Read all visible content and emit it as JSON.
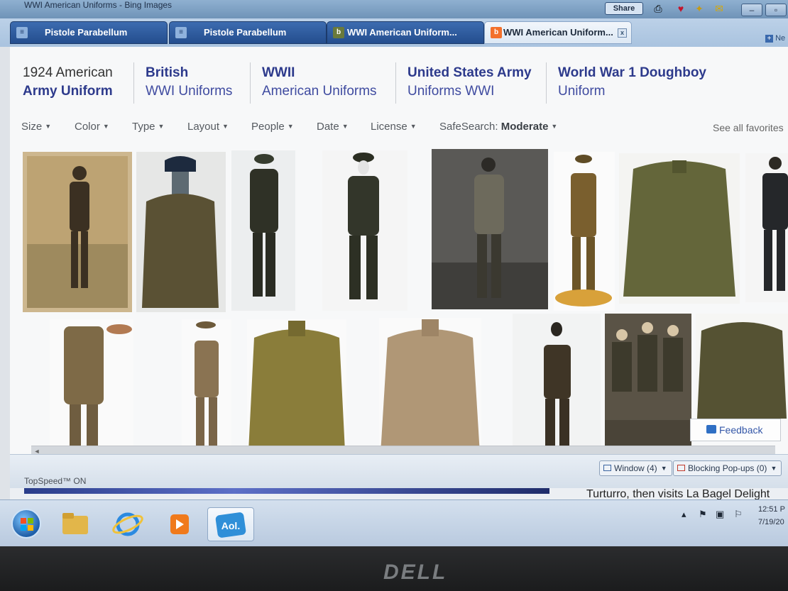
{
  "window": {
    "title": "WWI American Uniforms - Bing Images"
  },
  "toolbar": {
    "share_label": "Share"
  },
  "tabs": [
    {
      "label": "Pistole Parabellum",
      "active": false
    },
    {
      "label": "Pistole Parabellum",
      "active": false
    },
    {
      "label": "WWI American Uniform...",
      "active": false
    },
    {
      "label": "WWI American Uniform...",
      "active": true
    }
  ],
  "new_tab": {
    "label": "Ne"
  },
  "related_searches": [
    {
      "line1": "1924 American",
      "line2": "Army Uniform"
    },
    {
      "line1": "British",
      "line2": "WWI Uniforms"
    },
    {
      "line1": "WWII",
      "line2": "American Uniforms"
    },
    {
      "line1": "United States Army",
      "line2": "Uniforms WWI"
    },
    {
      "line1": "World War 1 Doughboy",
      "line2": "Uniform"
    }
  ],
  "filters": [
    "Size",
    "Color",
    "Type",
    "Layout",
    "People",
    "Date",
    "License"
  ],
  "safesearch": {
    "label": "SafeSearch:",
    "value": "Moderate"
  },
  "favorites_link": "See all favorites",
  "feedback": "Feedback",
  "statusbar": {
    "topspeed": "TopSpeed™ ON",
    "window_btn": "Window (4)",
    "popups_btn": "Blocking Pop-ups (0)"
  },
  "behind_window_text": "Turturro, then visits La Bagel Delight",
  "taskbar": {
    "apps": [
      {
        "name": "file-explorer"
      },
      {
        "name": "internet-explorer"
      },
      {
        "name": "media-player"
      },
      {
        "name": "aol",
        "label": "Aol."
      }
    ],
    "clock_time": "12:51 P",
    "clock_date": "7/19/20"
  },
  "monitor_brand": "DELL",
  "colors": {
    "link": "#2d3a8c",
    "tab_active_icon": "#f3702b",
    "tab_bg": "#244e8e"
  }
}
